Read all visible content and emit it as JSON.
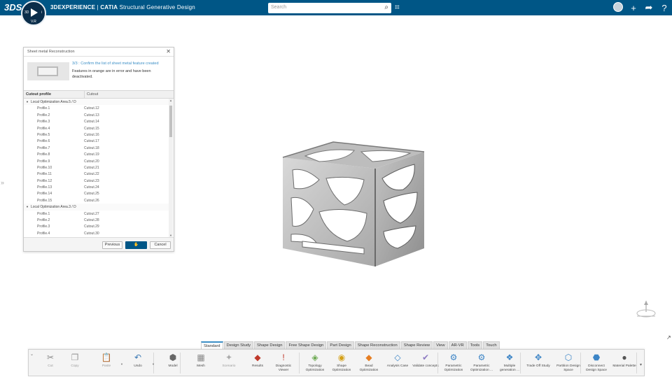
{
  "topbar": {
    "ds_logo": "3DS",
    "compass": {
      "left": "3D",
      "right": "i",
      "version": "V.R"
    },
    "brand_bold": "3DEXPERIENCE",
    "separator": " | ",
    "app_name": "CATIA",
    "app_module": "Structural Generative Design",
    "search_placeholder": "Search",
    "colors": {
      "bar": "#005686"
    }
  },
  "dialog": {
    "title": "Sheet metal Reconstruction",
    "close": "✕",
    "step": "3/3 : Confirm the list of sheet metal feature created",
    "description": "Features in orange are in error and have been deactivated.",
    "columns": [
      "Cutout profile",
      "Cutout"
    ],
    "groups": [
      {
        "name": "Local Optimization Area.5 / D",
        "rows": [
          [
            "Profile.1",
            "Cutout.12"
          ],
          [
            "Profile.2",
            "Cutout.13"
          ],
          [
            "Profile.3",
            "Cutout.14"
          ],
          [
            "Profile.4",
            "Cutout.15"
          ],
          [
            "Profile.5",
            "Cutout.16"
          ],
          [
            "Profile.6",
            "Cutout.17"
          ],
          [
            "Profile.7",
            "Cutout.18"
          ],
          [
            "Profile.8",
            "Cutout.19"
          ],
          [
            "Profile.9",
            "Cutout.20"
          ],
          [
            "Profile.10",
            "Cutout.21"
          ],
          [
            "Profile.11",
            "Cutout.22"
          ],
          [
            "Profile.12",
            "Cutout.23"
          ],
          [
            "Profile.13",
            "Cutout.24"
          ],
          [
            "Profile.14",
            "Cutout.25"
          ],
          [
            "Profile.15",
            "Cutout.26"
          ]
        ]
      },
      {
        "name": "Local Optimization Area.3 / D",
        "rows": [
          [
            "Profile.1",
            "Cutout.27"
          ],
          [
            "Profile.2",
            "Cutout.28"
          ],
          [
            "Profile.3",
            "Cutout.29"
          ],
          [
            "Profile.4",
            "Cutout.30"
          ]
        ]
      }
    ],
    "buttons": {
      "previous": "Previous",
      "ok_icon": "✋",
      "cancel": "Cancel"
    }
  },
  "tabs": [
    "Standard",
    "Design Study",
    "Shape Design",
    "Free Shape Design",
    "Part Design",
    "Shape Reconstruction",
    "Shape Review",
    "View",
    "AR-VR",
    "Tools",
    "Touch"
  ],
  "active_tab": "Standard",
  "tools": [
    {
      "name": "cut",
      "label": "Cut",
      "icon": "✂",
      "disabled": true
    },
    {
      "name": "copy",
      "label": "Copy",
      "icon": "❐",
      "disabled": true
    },
    {
      "name": "paste",
      "label": "Paste",
      "icon": "📋",
      "disabled": true
    },
    {
      "name": "undo",
      "label": "Undo",
      "icon": "↶",
      "disabled": false
    },
    {
      "name": "model",
      "label": "Model",
      "icon": "⬢",
      "disabled": false
    },
    {
      "name": "mesh",
      "label": "Mesh",
      "icon": "▦",
      "disabled": false
    },
    {
      "name": "scenario",
      "label": "Scenario",
      "icon": "✦",
      "disabled": true
    },
    {
      "name": "results",
      "label": "Results",
      "icon": "◆",
      "disabled": false
    },
    {
      "name": "diagnostic-viewer",
      "label": "Diagnostic Viewer",
      "icon": "!",
      "disabled": false
    },
    {
      "name": "topology-optimization",
      "label": "Topology Optimization",
      "icon": "◈",
      "disabled": false
    },
    {
      "name": "shape-optimization",
      "label": "Shape Optimization",
      "icon": "◉",
      "disabled": false
    },
    {
      "name": "bead-optimization",
      "label": "Bead Optimization",
      "icon": "◆",
      "disabled": false
    },
    {
      "name": "analysis-case",
      "label": "Analysis Case",
      "icon": "◇",
      "disabled": false
    },
    {
      "name": "validate-concepts",
      "label": "Validate concepts",
      "icon": "✔",
      "disabled": false
    },
    {
      "name": "parametric-optimization",
      "label": "Parametric Optimization",
      "icon": "⚙",
      "disabled": false
    },
    {
      "name": "parametric-optimization-2",
      "label": "Parametric Optimization ...",
      "icon": "⚙",
      "disabled": false
    },
    {
      "name": "multiple-generation",
      "label": "Multiple generation ...",
      "icon": "❖",
      "disabled": false
    },
    {
      "name": "trade-off-study",
      "label": "Trade Off Study",
      "icon": "✥",
      "disabled": false
    },
    {
      "name": "partition-design-space",
      "label": "Partition Design Space",
      "icon": "⬡",
      "disabled": false
    },
    {
      "name": "disconnect-design-space",
      "label": "Disconnect Design Space",
      "icon": "⬣",
      "disabled": false
    },
    {
      "name": "material-palette",
      "label": "Material Palette",
      "icon": "●",
      "disabled": false
    }
  ]
}
